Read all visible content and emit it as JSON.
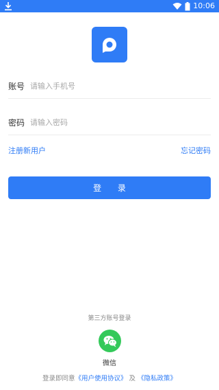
{
  "status_bar": {
    "time": "10:06",
    "icons": [
      "download-icon",
      "wifi-icon",
      "battery-icon"
    ]
  },
  "form": {
    "account_label": "账号",
    "account_placeholder": "请输入手机号",
    "password_label": "密码",
    "password_placeholder": "请输入密码"
  },
  "links": {
    "register": "注册新用户",
    "forgot_password": "忘记密码"
  },
  "login_button": "登 录",
  "third_party": {
    "title": "第三方账号登录",
    "wechat_label": "微信"
  },
  "agreement": {
    "prefix": "登录即同意",
    "user_agreement": "《用户使用协议》",
    "and": "及",
    "privacy_policy": "《隐私政策》"
  },
  "colors": {
    "accent": "#2f7cf6",
    "wechat": "#34c95a"
  }
}
